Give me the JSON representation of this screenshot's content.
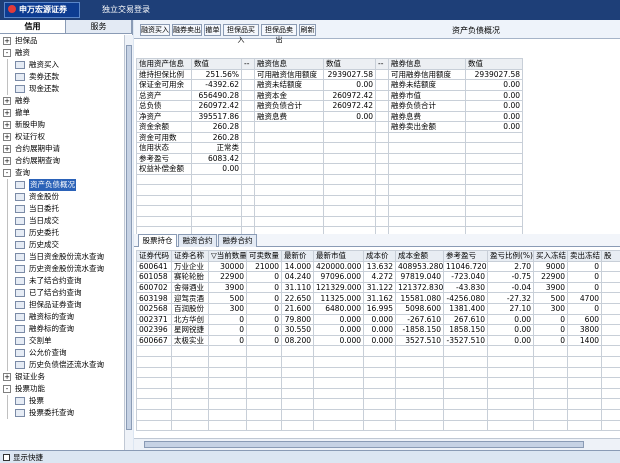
{
  "app": {
    "logo_text": "申万宏源证券",
    "window_title": "独立交易登录"
  },
  "left_tabs": [
    "信用",
    "服务"
  ],
  "tree": [
    {
      "label": "担保品",
      "level": 0,
      "exp": "+"
    },
    {
      "label": "融资",
      "level": 0,
      "exp": "-"
    },
    {
      "label": "融资买入",
      "level": 1
    },
    {
      "label": "卖券还款",
      "level": 1
    },
    {
      "label": "现金还款",
      "level": 1
    },
    {
      "label": "融券",
      "level": 0,
      "exp": "+"
    },
    {
      "label": "撤单",
      "level": 0,
      "exp": "+"
    },
    {
      "label": "新股申购",
      "level": 0,
      "exp": "+"
    },
    {
      "label": "权证行权",
      "level": 0,
      "exp": "+"
    },
    {
      "label": "合约展期申请",
      "level": 0,
      "exp": "+"
    },
    {
      "label": "合约展期查询",
      "level": 0,
      "exp": "+"
    },
    {
      "label": "查询",
      "level": 0,
      "exp": "-"
    },
    {
      "label": "资产负债概况",
      "level": 1,
      "selected": true
    },
    {
      "label": "资金股份",
      "level": 1
    },
    {
      "label": "当日委托",
      "level": 1
    },
    {
      "label": "当日成交",
      "level": 1
    },
    {
      "label": "历史委托",
      "level": 1
    },
    {
      "label": "历史成交",
      "level": 1
    },
    {
      "label": "当日资金股份流水查询",
      "level": 1
    },
    {
      "label": "历史资金股份流水查询",
      "level": 1
    },
    {
      "label": "未了结合约查询",
      "level": 1
    },
    {
      "label": "已了结合约查询",
      "level": 1
    },
    {
      "label": "担保品证券查询",
      "level": 1
    },
    {
      "label": "融资标的查询",
      "level": 1
    },
    {
      "label": "融券标的查询",
      "level": 1
    },
    {
      "label": "交割单",
      "level": 1
    },
    {
      "label": "公允价查询",
      "level": 1
    },
    {
      "label": "历史负债偿还流水查询",
      "level": 1
    },
    {
      "label": "银证业务",
      "level": 0,
      "exp": "+"
    },
    {
      "label": "投票功能",
      "level": 0,
      "exp": "-"
    },
    {
      "label": "投票",
      "level": 1
    },
    {
      "label": "投票委托查询",
      "level": 1
    }
  ],
  "bottom": {
    "show_quick": "显示快捷"
  },
  "toolbar": {
    "buttons": [
      "融资买入",
      "融券卖出",
      "撤单",
      "担保品买入",
      "担保品卖出",
      "刷新"
    ],
    "pane_title": "资产负债概况"
  },
  "summary": {
    "headers": [
      "信用资产信息",
      "数值",
      "--",
      "融资信息",
      "数值",
      "--",
      "融券信息",
      "数值"
    ],
    "rows": [
      [
        "维持担保比例",
        "251.56%",
        "",
        "可用融资信用额度",
        "2939027.58",
        "",
        "可用融券信用额度",
        "2939027.58"
      ],
      [
        "保证金可用余",
        "-4392.62",
        "",
        "融资未结额度",
        "0.00",
        "",
        "融券未结额度",
        "0.00"
      ],
      [
        "总资产",
        "656490.28",
        "",
        "融资本金",
        "260972.42",
        "",
        "融券市值",
        "0.00"
      ],
      [
        "总负债",
        "260972.42",
        "",
        "融资负债合计",
        "260972.42",
        "",
        "融券负债合计",
        "0.00"
      ],
      [
        "净资产",
        "395517.86",
        "",
        "融资息费",
        "0.00",
        "",
        "融券息费",
        "0.00"
      ],
      [
        "资金余额",
        "260.28",
        "",
        "",
        "",
        "",
        "融券卖出金额",
        "0.00"
      ],
      [
        "资金可用数",
        "260.28",
        "",
        "",
        "",
        "",
        "",
        ""
      ],
      [
        "信用状态",
        "正常类",
        "",
        "",
        "",
        "",
        "",
        ""
      ],
      [
        "参考盈亏",
        "6083.42",
        "",
        "",
        "",
        "",
        "",
        ""
      ],
      [
        "权益补偿金额",
        "0.00",
        "",
        "",
        "",
        "",
        "",
        ""
      ],
      [
        "",
        "",
        "",
        "",
        "",
        "",
        "",
        ""
      ],
      [
        "",
        "",
        "",
        "",
        "",
        "",
        "",
        ""
      ],
      [
        "",
        "",
        "",
        "",
        "",
        "",
        "",
        ""
      ],
      [
        "",
        "",
        "",
        "",
        "",
        "",
        "",
        ""
      ],
      [
        "",
        "",
        "",
        "",
        "",
        "",
        "",
        ""
      ],
      [
        "",
        "",
        "",
        "",
        "",
        "",
        "",
        ""
      ]
    ]
  },
  "bottom_tabs": [
    "股票持仓",
    "融资合约",
    "融券合约"
  ],
  "positions": {
    "headers": [
      "证券代码",
      "证券名称",
      "▽当前数量",
      "可卖数量",
      "最新价",
      "最新市值",
      "成本价",
      "成本金额",
      "参考盈亏",
      "盈亏比例(%)",
      "买入冻结",
      "卖出冻结",
      "股"
    ],
    "rows": [
      [
        "600641",
        "万业企业",
        "30000",
        "21000",
        "14.000",
        "420000.000",
        "13.632",
        "408953.280",
        "11046.720",
        "2.70",
        "9000",
        "0",
        ""
      ],
      [
        "601058",
        "赛轮轮胎",
        "22900",
        "0",
        "04.240",
        "97096.000",
        "4.272",
        "97819.040",
        "-723.040",
        "-0.75",
        "22900",
        "0",
        ""
      ],
      [
        "600702",
        "舍得酒业",
        "3900",
        "0",
        "31.110",
        "121329.000",
        "31.122",
        "121372.830",
        "-43.830",
        "-0.04",
        "3900",
        "0",
        ""
      ],
      [
        "603198",
        "迎驾贡酒",
        "500",
        "0",
        "22.650",
        "11325.000",
        "31.162",
        "15581.080",
        "-4256.080",
        "-27.32",
        "500",
        "4700",
        ""
      ],
      [
        "002568",
        "百润股份",
        "300",
        "0",
        "21.600",
        "6480.000",
        "16.995",
        "5098.600",
        "1381.400",
        "27.10",
        "300",
        "0",
        ""
      ],
      [
        "002371",
        "北方华创",
        "0",
        "0",
        "79.800",
        "0.000",
        "0.000",
        "-267.610",
        "267.610",
        "0.00",
        "0",
        "600",
        ""
      ],
      [
        "002396",
        "星网锐捷",
        "0",
        "0",
        "30.550",
        "0.000",
        "0.000",
        "-1858.150",
        "1858.150",
        "0.00",
        "0",
        "3800",
        ""
      ],
      [
        "600667",
        "太极实业",
        "0",
        "0",
        "08.200",
        "0.000",
        "0.000",
        "3527.510",
        "-3527.510",
        "0.00",
        "0",
        "1400",
        ""
      ],
      [
        "",
        "",
        "",
        "",
        "",
        "",
        "",
        "",
        "",
        "",
        "",
        "",
        ""
      ],
      [
        "",
        "",
        "",
        "",
        "",
        "",
        "",
        "",
        "",
        "",
        "",
        "",
        ""
      ],
      [
        "",
        "",
        "",
        "",
        "",
        "",
        "",
        "",
        "",
        "",
        "",
        "",
        ""
      ],
      [
        "",
        "",
        "",
        "",
        "",
        "",
        "",
        "",
        "",
        "",
        "",
        "",
        ""
      ],
      [
        "",
        "",
        "",
        "",
        "",
        "",
        "",
        "",
        "",
        "",
        "",
        "",
        ""
      ],
      [
        "",
        "",
        "",
        "",
        "",
        "",
        "",
        "",
        "",
        "",
        "",
        "",
        ""
      ],
      [
        "",
        "",
        "",
        "",
        "",
        "",
        "",
        "",
        "",
        "",
        "",
        "",
        ""
      ],
      [
        "",
        "",
        "",
        "",
        "",
        "",
        "",
        "",
        "",
        "",
        "",
        "",
        ""
      ]
    ]
  }
}
